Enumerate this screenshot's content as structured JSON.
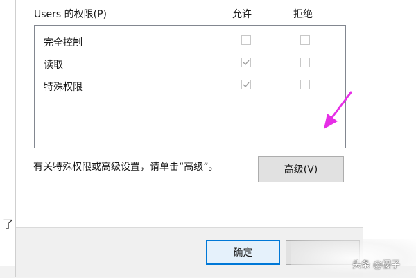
{
  "background": {
    "glyph": "了"
  },
  "permissions": {
    "title": "Users 的权限(P)",
    "allow_header": "允许",
    "deny_header": "拒绝",
    "rows": [
      {
        "label": "完全控制",
        "allow": false,
        "deny": false
      },
      {
        "label": "读取",
        "allow": true,
        "deny": false
      },
      {
        "label": "特殊权限",
        "allow": true,
        "deny": false
      }
    ]
  },
  "advanced": {
    "hint": "有关特殊权限或高级设置，请单击“高级”。",
    "button_label": "高级(V)"
  },
  "footer": {
    "ok_label": "确定"
  },
  "annotation": {
    "color": "#e62ee6",
    "icon": "arrow-pointer-icon"
  },
  "watermark": {
    "text": "头条 @樱子"
  }
}
